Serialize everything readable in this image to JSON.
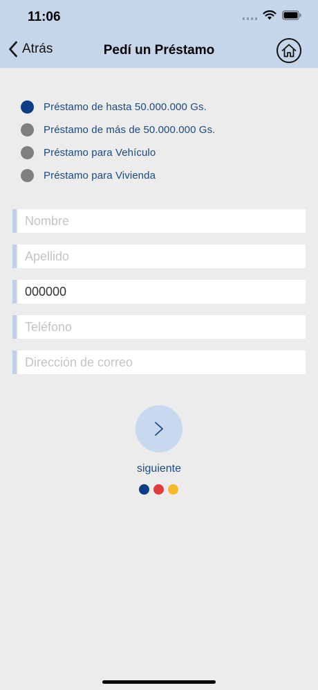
{
  "status_bar": {
    "time": "11:06"
  },
  "nav": {
    "back_label": "Atrás",
    "title": "Pedí un Préstamo"
  },
  "loan_options": [
    {
      "label": "Préstamo de hasta 50.000.000 Gs.",
      "selected": true
    },
    {
      "label": "Préstamo de más de 50.000.000 Gs.",
      "selected": false
    },
    {
      "label": "Préstamo para Vehículo",
      "selected": false
    },
    {
      "label": "Préstamo para Vivienda",
      "selected": false
    }
  ],
  "form": {
    "nombre": {
      "placeholder": "Nombre",
      "value": ""
    },
    "apellido": {
      "placeholder": "Apellido",
      "value": ""
    },
    "documento": {
      "placeholder": "",
      "value": "000000"
    },
    "telefono": {
      "placeholder": "Teléfono",
      "value": ""
    },
    "correo": {
      "placeholder": "Dirección de correo",
      "value": ""
    }
  },
  "next": {
    "label": "siguiente"
  },
  "colors": {
    "header_bg": "#c5d5ea",
    "accent_blue": "#0c3e85",
    "dot_blue": "#0c3e85",
    "dot_red": "#e23c3c",
    "dot_yellow": "#f7b928"
  },
  "icons": {
    "back": "chevron-left-icon",
    "home": "home-icon",
    "next": "chevron-right-icon"
  }
}
